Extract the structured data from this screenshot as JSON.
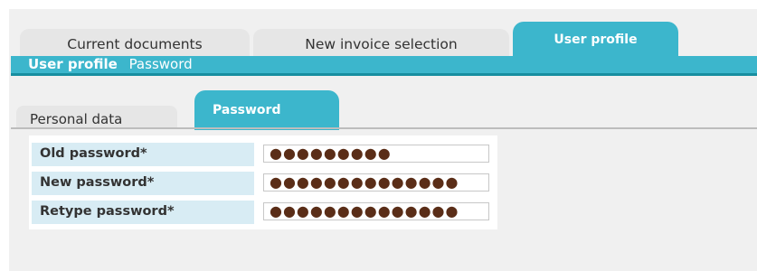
{
  "tabs": {
    "current_documents": "Current documents",
    "new_invoice_selection": "New invoice selection",
    "user_profile": "User profile"
  },
  "breadcrumb": {
    "active": "User profile",
    "item": "Password"
  },
  "subtabs": {
    "personal_data": "Personal data",
    "password": "Password"
  },
  "form": {
    "old_password_label": "Old password*",
    "new_password_label": "New password*",
    "retype_password_label": "Retype password*",
    "old_password_value": "●●●●●●●●●",
    "new_password_value": "●●●●●●●●●●●●●●",
    "retype_password_value": "●●●●●●●●●●●●●●"
  },
  "colors": {
    "accent": "#3cb6cc",
    "accent_dark": "#178ea0",
    "label_bg": "#d8ecf4",
    "background": "#f0f0f0"
  }
}
